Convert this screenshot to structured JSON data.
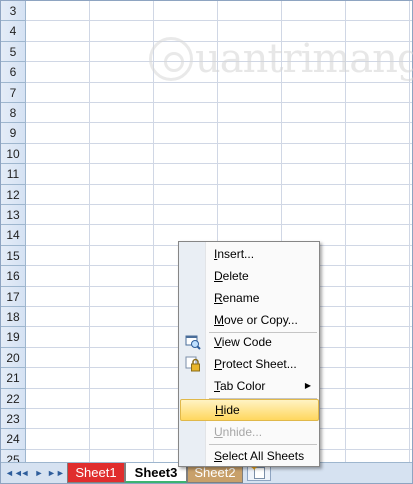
{
  "rows": [
    "3",
    "4",
    "5",
    "6",
    "7",
    "8",
    "9",
    "10",
    "11",
    "12",
    "13",
    "14",
    "15",
    "16",
    "17",
    "18",
    "19",
    "20",
    "21",
    "22",
    "23",
    "24",
    "25"
  ],
  "watermark": "uantrimang",
  "sheet_tabs": {
    "nav": [
      "◄◄",
      "◄",
      "►",
      "►►"
    ],
    "tab1": "Sheet1",
    "tab2": "Sheet3",
    "tab3": "Sheet2"
  },
  "context_menu": {
    "items": [
      {
        "label": "Insert...",
        "underline_index": 0
      },
      {
        "label": "Delete",
        "underline_index": 0
      },
      {
        "label": "Rename",
        "underline_index": 0
      },
      {
        "label": "Move or Copy...",
        "underline_index": 0
      },
      {
        "label": "View Code",
        "underline_index": 0,
        "icon": "view-code-icon"
      },
      {
        "label": "Protect Sheet...",
        "underline_index": 0,
        "icon": "protect-sheet-icon"
      },
      {
        "label": "Tab Color",
        "underline_index": 0,
        "submenu": true
      },
      {
        "label": "Hide",
        "underline_index": 0,
        "highlighted": true
      },
      {
        "label": "Unhide...",
        "underline_index": 0,
        "disabled": true
      },
      {
        "label": "Select All Sheets",
        "underline_index": 0
      }
    ]
  },
  "colors": {
    "tab_sheet1": "#e02d2d",
    "tab_sheet2": "#c8a06a",
    "menu_highlight": "#ffd75e"
  }
}
